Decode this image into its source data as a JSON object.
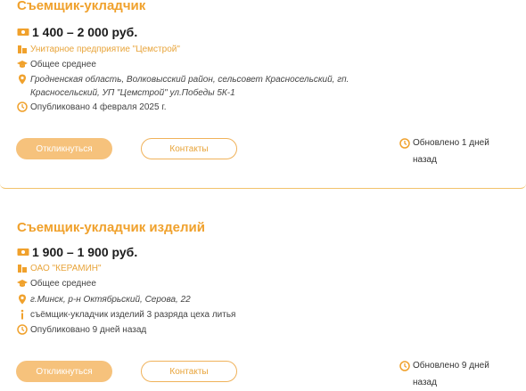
{
  "jobs": [
    {
      "title": "Съемщик-укладчик",
      "salary": "1 400 – 2 000 руб.",
      "company": "Унитарное предприятие \"Цемстрой\"",
      "education": "Общее среднее",
      "address_line1": "Гродненская область, Волковысский район, сельсовет Красносельский, гп.",
      "address_line2": "Красносельский, УП \"Цемстрой\" ул.Победы 5К-1",
      "published": "Опубликовано 4 февраля 2025 г.",
      "apply_label": "Откликнуться",
      "contacts_label": "Контакты",
      "updated": "Обновлено 1 дней назад"
    },
    {
      "title": "Съемщик-укладчик изделий",
      "salary": "1 900 – 1 900 руб.",
      "company": "ОАО \"КЕРАМИН\"",
      "education": "Общее среднее",
      "address": "г.Минск, р-н Октябрьский, Серова, 22",
      "info": "съёмщик-укладчик изделий 3 разряда цеха литья",
      "published": "Опубликовано 9 дней назад",
      "apply_label": "Откликнуться",
      "contacts_label": "Контакты",
      "updated": "Обновлено 9 дней назад"
    }
  ],
  "colors": {
    "accent": "#f0a12c",
    "button": "#f6c27c",
    "divider": "#f2c36b"
  },
  "icons": [
    "money-icon",
    "building-icon",
    "graduation-cap-icon",
    "location-pin-icon",
    "info-icon",
    "clock-icon"
  ]
}
